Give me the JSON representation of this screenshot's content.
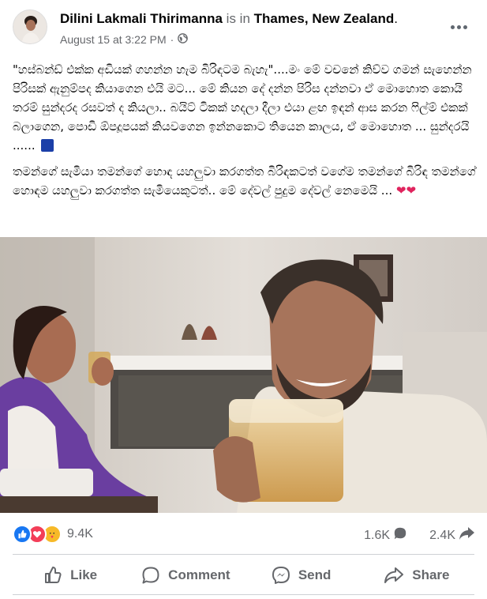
{
  "post": {
    "author": "Dilini Lakmali Thirimanna",
    "is_in": "is in",
    "location": "Thames, New Zealand",
    "period": ".",
    "date": "August 15 at 3:22 PM",
    "separator": "·",
    "privacy_icon": "globe-icon",
    "more_icon": "more-options-icon",
    "paragraph1": "\"හස්බන්ඩ් එක්ක අඩියක් ගහන්න හැම බිරිඳටම බැහැ\"....මං මේ වචනේ කිව්ව ගමන් සැහෙන්න පිරිසක් ඇනුම්පද කියාගෙන එයි මට... මේ කියන දේ දන්න පිරිස දන්නවා ඒ මොහොත කොයි තරම් සුන්දරද රසවත් ද කියලා.. බයිට් ටිකක් හදලා දීලා එයා ළඟ ඉඳන් ආස කරන ෆිල්ම් එකක් බලාගෙන, පොඩි ඕපදූපයක් කියවගෙන ඉන්නකොට තියෙන කාලය, ඒ මොහොත ... සුන්දරයි ......",
    "paragraph1_emoji": "blue-heart-icon",
    "paragraph2": "තමන්ගේ සැමියා තමන්ගේ හොඳ යහලුවා කරගත්ත බිරිඳකටත් වගේම තමන්ගේ බිරිඳ තමන්ගේ හොඳම යහලුවා කරගත්ත සැමියෙකුටත්.. මේ දේවල් පුදුම දේවල් නෙමෙයි ...",
    "paragraph2_emoji": "❤❤"
  },
  "stats": {
    "reaction_icons": [
      "like-icon",
      "love-icon",
      "care-icon"
    ],
    "reaction_count": "9.4K",
    "comments_count": "1.6K",
    "shares_count": "2.4K"
  },
  "actions": {
    "like": "Like",
    "comment": "Comment",
    "send": "Send",
    "share": "Share"
  },
  "colors": {
    "text": "#050505",
    "secondary": "#65676b",
    "like_blue": "#1877f2",
    "love_red": "#f33e58",
    "care_yellow": "#f7b928",
    "divider": "#ced0d4"
  }
}
